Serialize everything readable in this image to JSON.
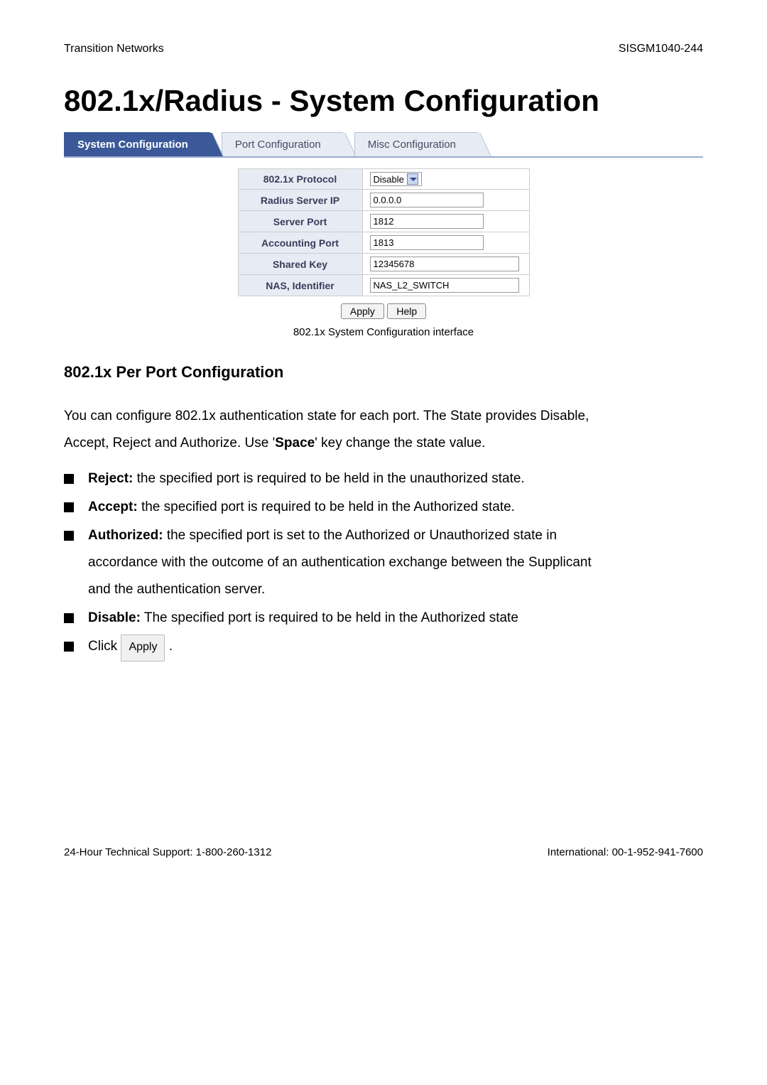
{
  "header": {
    "left": "Transition Networks",
    "right": "SISGM1040-244"
  },
  "title": "802.1x/Radius - System Configuration",
  "tabs": {
    "active": "System Configuration",
    "t2": "Port Configuration",
    "t3": "Misc Configuration"
  },
  "form": {
    "rows": [
      {
        "label": "802.1x Protocol",
        "type": "dropdown",
        "value": "Disable"
      },
      {
        "label": "Radius Server IP",
        "type": "text",
        "value": "0.0.0.0"
      },
      {
        "label": "Server Port",
        "type": "text",
        "value": "1812"
      },
      {
        "label": "Accounting Port",
        "type": "text",
        "value": "1813"
      },
      {
        "label": "Shared Key",
        "type": "wide",
        "value": "12345678"
      },
      {
        "label": "NAS, Identifier",
        "type": "wide",
        "value": "NAS_L2_SWITCH"
      }
    ],
    "buttons": {
      "apply": "Apply",
      "help": "Help"
    }
  },
  "caption": "802.1x System Configuration interface",
  "section": "802.1x Per Port Configuration",
  "intro1": "You can configure 802.1x authentication state for each port. The State provides Disable,",
  "intro2_a": "Accept, Reject and Authorize. Use '",
  "intro2_b": "Space",
  "intro2_c": "' key change the state value.",
  "bullets": {
    "reject_b": "Reject:",
    "reject_t": " the specified port is required to be held in the unauthorized state.",
    "accept_b": "Accept:",
    "accept_t": " the specified port is required to be held in the Authorized state.",
    "auth_b": "Authorized:",
    "auth_t1": " the specified port is set to the Authorized or Unauthorized state in",
    "auth_t2": "accordance with the outcome of an authentication exchange between the Supplicant",
    "auth_t3": "and the authentication server.",
    "disable_b": "Disable:",
    "disable_t": " The specified port is required to be held in the Authorized state",
    "click": "Click ",
    "apply_btn": "Apply",
    "click_end": " ."
  },
  "footer": {
    "left": "24-Hour Technical Support: 1-800-260-1312",
    "right": "International: 00-1-952-941-7600"
  }
}
